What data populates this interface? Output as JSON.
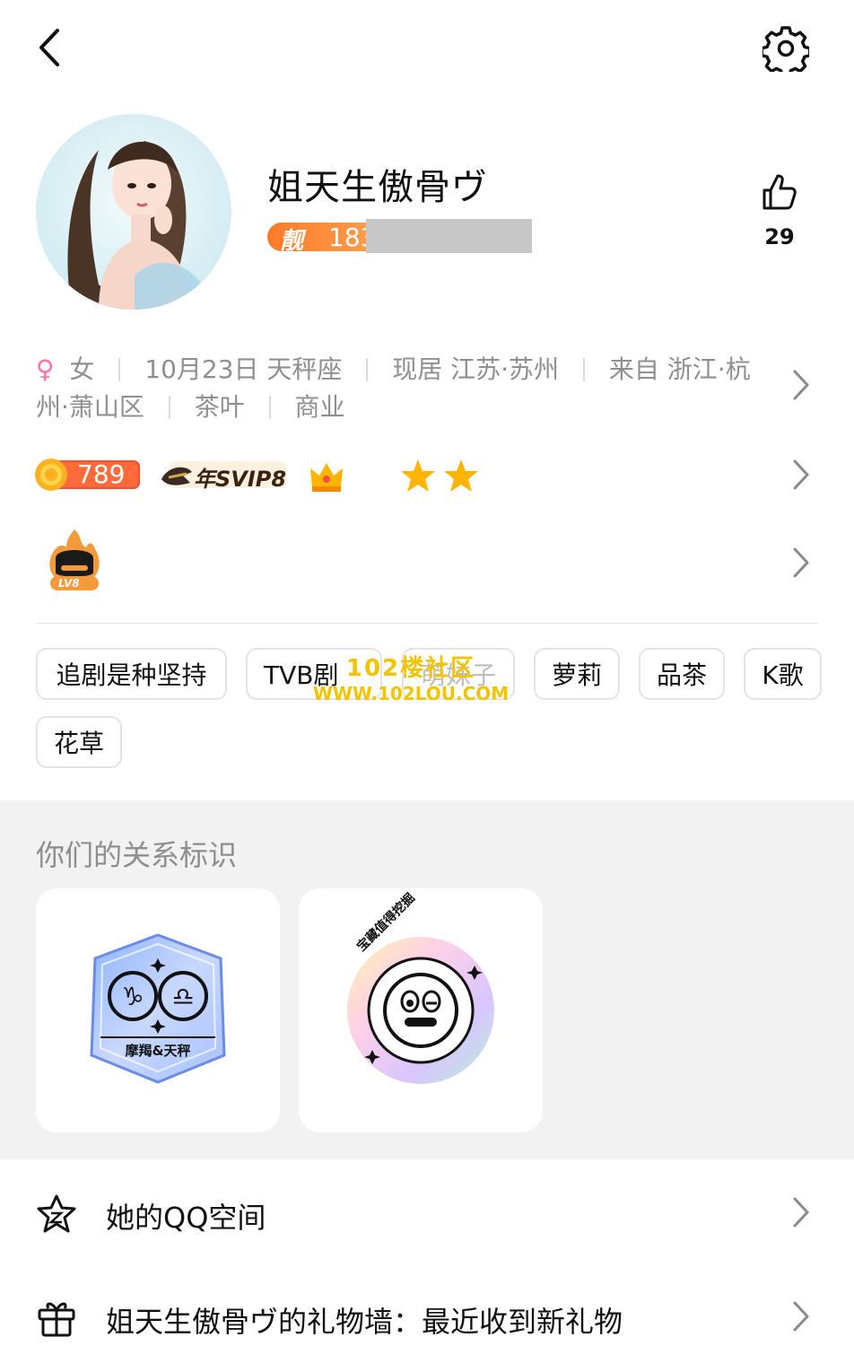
{
  "profile": {
    "nickname": "姐天生傲骨ヴ",
    "liang_char": "靓",
    "liang_number": "183",
    "like_count": "29"
  },
  "info": {
    "gender_symbol": "♀",
    "gender": "女",
    "birthday": "10月23日 天秤座",
    "residence": "现居 江苏·苏州",
    "hometown_part1": "来自 浙江·杭",
    "hometown_part2": "州·萧山区",
    "hobby": "茶叶",
    "industry": "商业"
  },
  "badges": {
    "coin": "789",
    "svip": "年SVIP8",
    "lv8": "LV8"
  },
  "tags": [
    "追剧是种坚持",
    "TVB剧",
    "萌妹子",
    "萝莉",
    "品茶",
    "K歌",
    "花草"
  ],
  "watermark": {
    "line1": "102楼社区",
    "line2": "WWW.102LOU.COM"
  },
  "relationship": {
    "title": "你们的关系标识",
    "zodiac_label": "摩羯&天秤",
    "treasure_text": "宝藏值得挖掘"
  },
  "list": {
    "qzone": "她的QQ空间",
    "gift_wall": "姐天生傲骨ヴ的礼物墙：最近收到新礼物"
  },
  "colors": {
    "accent_orange": "#ff8a3a",
    "gray_text": "#8f8f8f",
    "female_pink": "#ff6fa8"
  }
}
